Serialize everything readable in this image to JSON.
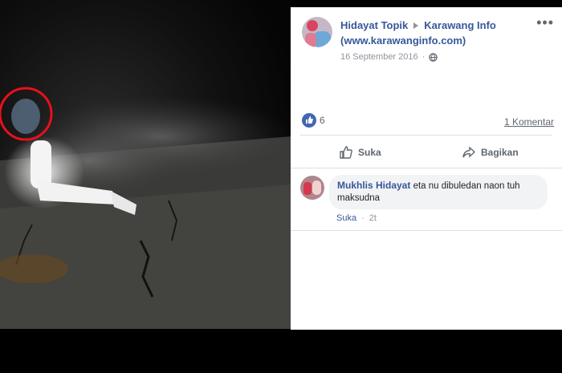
{
  "post": {
    "author": "Hidayat Topik",
    "group": "Karawang Info",
    "group_url": "(www.karawanginfo.com)",
    "date": "16 September 2016",
    "like_count": "6",
    "comment_count": "1 Komentar"
  },
  "actions": {
    "like_label": "Suka",
    "share_label": "Bagikan"
  },
  "comment": {
    "author": "Mukhlis Hidayat",
    "text_line1": "eta nu dibuledan naon tuh",
    "text_line2": "maksudna",
    "like_label": "Suka",
    "time": "2t"
  },
  "colors": {
    "link": "#365899",
    "like_blue": "#4267b2",
    "highlight_circle": "#e8101b"
  },
  "icons": [
    "privacy-globe-icon",
    "like-reaction-icon",
    "thumbs-up-icon",
    "share-arrow-icon",
    "more-options-icon",
    "arrow-right-icon"
  ]
}
